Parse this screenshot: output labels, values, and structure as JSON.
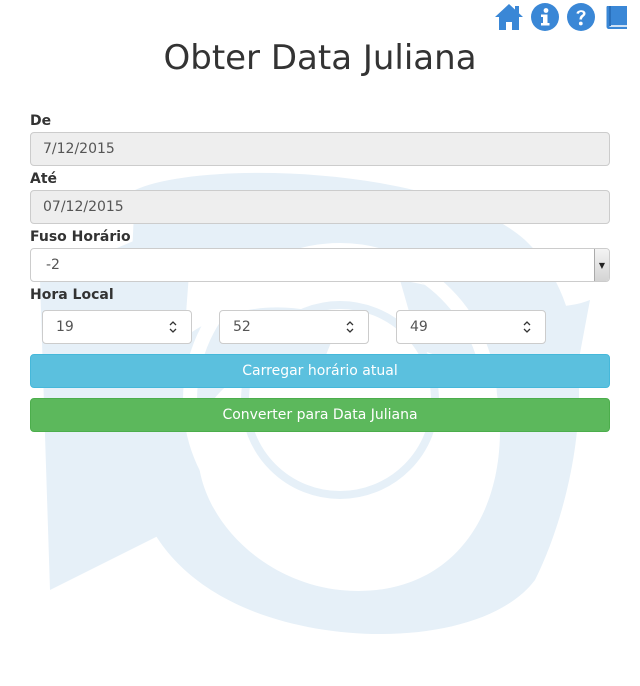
{
  "header": {
    "title": "Obter Data Juliana",
    "icons": [
      "home-icon",
      "info-icon",
      "help-icon",
      "book-icon"
    ]
  },
  "form": {
    "from": {
      "label": "De",
      "value": "7/12/2015"
    },
    "to": {
      "label": "Até",
      "value": "07/12/2015"
    },
    "timezone": {
      "label": "Fuso Horário",
      "value": "-2"
    },
    "local_time": {
      "label": "Hora Local",
      "hour": "19",
      "minute": "52",
      "second": "49"
    }
  },
  "buttons": {
    "load_current": "Carregar horário atual",
    "convert": "Converter para Data Juliana"
  },
  "colors": {
    "icon_blue": "#3a87d6",
    "info_button": "#5bc0de",
    "success_button": "#5cb85c",
    "watermark": "#e6f0f8"
  }
}
